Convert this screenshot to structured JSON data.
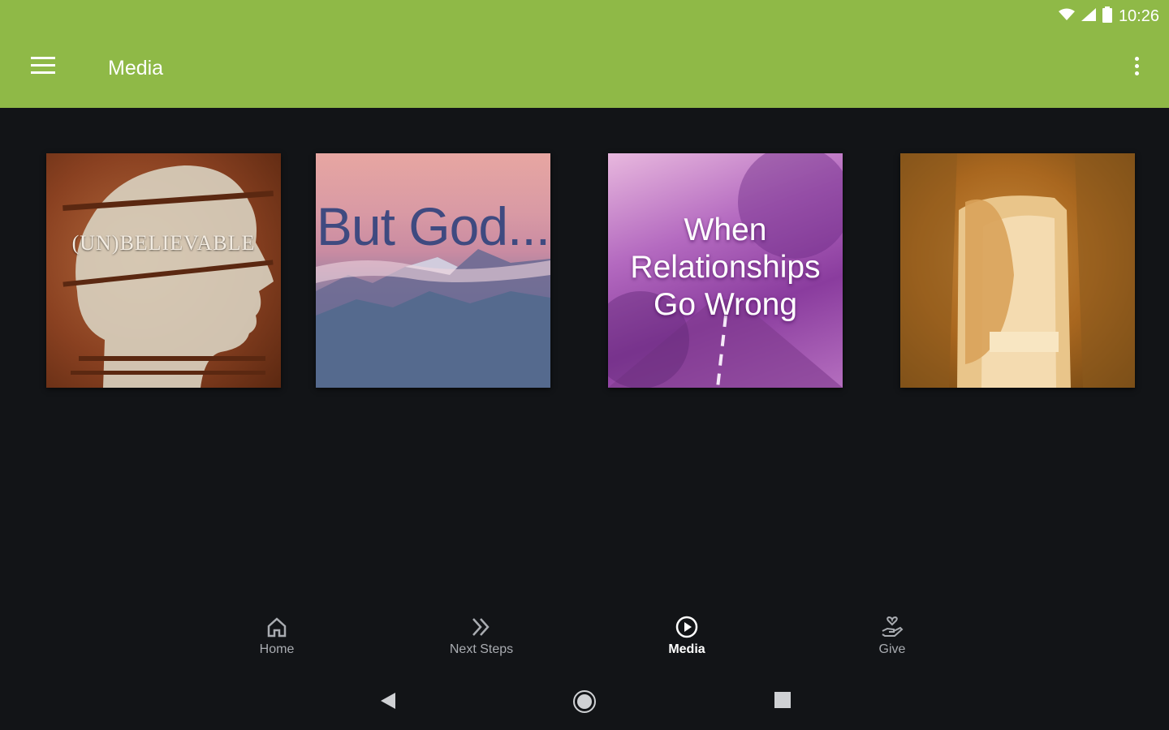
{
  "status_bar": {
    "time": "10:26",
    "icons": [
      "wifi-icon",
      "signal-icon",
      "battery-icon"
    ]
  },
  "app_bar": {
    "title": "Media",
    "menu_icon": "hamburger-menu-icon",
    "overflow_icon": "more-vert-icon",
    "color": "#8fb947"
  },
  "media_tiles": [
    {
      "title": "(UN)BELIEVABLE"
    },
    {
      "title": "But God..."
    },
    {
      "title_lines": [
        "When",
        "Relationships",
        "Go Wrong"
      ]
    },
    {
      "title": ""
    }
  ],
  "bottom_nav": {
    "items": [
      {
        "label": "Home",
        "icon": "home-icon"
      },
      {
        "label": "Next Steps",
        "icon": "double-chevron-icon"
      },
      {
        "label": "Media",
        "icon": "play-circle-icon",
        "active": true
      },
      {
        "label": "Give",
        "icon": "give-hand-icon"
      }
    ]
  },
  "system_nav": {
    "icons": [
      "back-icon",
      "home-circle-icon",
      "recents-icon"
    ]
  }
}
